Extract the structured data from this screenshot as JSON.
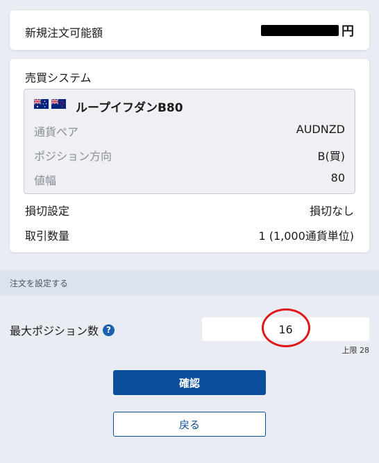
{
  "order_amount": {
    "label": "新規注文可能額",
    "currency": "円"
  },
  "system": {
    "title": "売買システム",
    "strategy_name": "ループイフダンB80",
    "details": [
      {
        "label": "通貨ペア",
        "value": "AUDNZD"
      },
      {
        "label": "ポジション方向",
        "value": "B(買)"
      },
      {
        "label": "値幅",
        "value": "80"
      }
    ],
    "stop_loss": {
      "label": "損切設定",
      "value": "損切なし"
    },
    "quantity": {
      "label": "取引数量",
      "value": "1 (1,000通貨単位)"
    }
  },
  "order_section": {
    "title": "注文を設定する"
  },
  "max_positions": {
    "label": "最大ポジション数",
    "value": "16",
    "limit_text": "上限 28",
    "help_icon": "question-circle-icon"
  },
  "buttons": {
    "confirm": "確認",
    "back": "戻る"
  },
  "colors": {
    "primary": "#0b4f9c",
    "annotation": "#e0161b",
    "background": "#e9edf3"
  }
}
